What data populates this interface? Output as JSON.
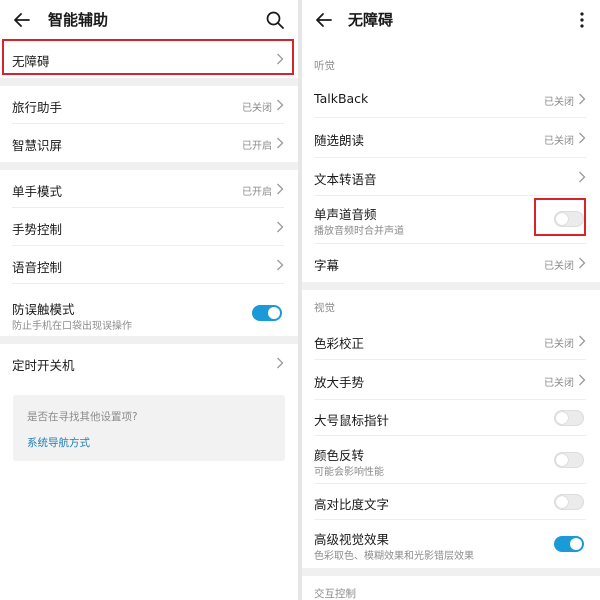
{
  "colors": {
    "accent": "#1a9ad6",
    "link": "#1f7fb3",
    "highlight": "#d8232a",
    "secondary_text": "#8c8c8c"
  },
  "left": {
    "title": "智能辅助",
    "items": {
      "accessibility": {
        "label": "无障碍"
      },
      "travel_assistant": {
        "label": "旅行助手",
        "value": "已关闭"
      },
      "smart_screen": {
        "label": "智慧识屏",
        "value": "已开启"
      },
      "one_hand": {
        "label": "单手模式",
        "value": "已开启"
      },
      "gesture": {
        "label": "手势控制"
      },
      "voice": {
        "label": "语音控制"
      },
      "anti_mistouch": {
        "label": "防误触模式",
        "subtitle": "防止手机在口袋出现误操作",
        "on": true
      },
      "scheduled_power": {
        "label": "定时开关机"
      }
    },
    "help": {
      "question": "是否在寻找其他设置项?",
      "link": "系统导航方式"
    }
  },
  "right": {
    "title": "无障碍",
    "sections": {
      "hearing": "听觉",
      "vision": "视觉",
      "interaction": "交互控制"
    },
    "items": {
      "talkback": {
        "label": "TalkBack",
        "value": "已关闭"
      },
      "select_to_speak": {
        "label": "随选朗读",
        "value": "已关闭"
      },
      "tts": {
        "label": "文本转语音"
      },
      "mono_audio": {
        "label": "单声道音频",
        "subtitle": "播放音频时合并声道",
        "on": false
      },
      "captions": {
        "label": "字幕",
        "value": "已关闭"
      },
      "color_correction": {
        "label": "色彩校正",
        "value": "已关闭"
      },
      "magnification": {
        "label": "放大手势",
        "value": "已关闭"
      },
      "large_pointer": {
        "label": "大号鼠标指针",
        "on": false
      },
      "color_inversion": {
        "label": "颜色反转",
        "subtitle": "可能会影响性能",
        "on": false
      },
      "high_contrast": {
        "label": "高对比度文字",
        "on": false
      },
      "advanced_visual": {
        "label": "高级视觉效果",
        "subtitle": "色彩取色、模糊效果和光影错层效果",
        "on": true
      }
    }
  },
  "icons": {
    "back": "arrow-left-icon",
    "search": "search-icon",
    "more": "more-vertical-icon",
    "chevron": "chevron-right-icon"
  }
}
